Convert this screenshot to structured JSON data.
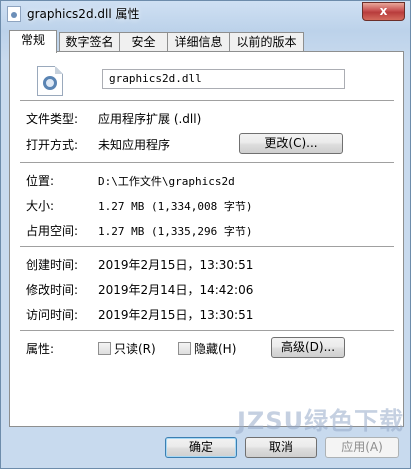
{
  "window": {
    "title": "graphics2d.dll 属性",
    "close_label": "x"
  },
  "tabs": [
    {
      "label": "常规",
      "active": true
    },
    {
      "label": "数字签名",
      "active": false
    },
    {
      "label": "安全",
      "active": false
    },
    {
      "label": "详细信息",
      "active": false
    },
    {
      "label": "以前的版本",
      "active": false
    }
  ],
  "general": {
    "file_name": "graphics2d.dll",
    "file_type_label": "文件类型:",
    "file_type_value": "应用程序扩展 (.dll)",
    "open_with_label": "打开方式:",
    "open_with_value": "未知应用程序",
    "change_button": "更改(C)...",
    "location_label": "位置:",
    "location_value": "D:\\工作文件\\graphics2d",
    "size_label": "大小:",
    "size_value": "1.27 MB (1,334,008 字节)",
    "size_on_disk_label": "占用空间:",
    "size_on_disk_value": "1.27 MB (1,335,296 字节)",
    "created_label": "创建时间:",
    "created_value": "2019年2月15日，13:30:51",
    "modified_label": "修改时间:",
    "modified_value": "2019年2月14日，14:42:06",
    "accessed_label": "访问时间:",
    "accessed_value": "2019年2月15日，13:30:51",
    "attributes_label": "属性:",
    "readonly_label": "只读(R)",
    "hidden_label": "隐藏(H)",
    "advanced_button": "高级(D)..."
  },
  "footer": {
    "ok": "确定",
    "cancel": "取消",
    "apply": "应用(A)"
  },
  "watermark": "JZSU绿色下载"
}
